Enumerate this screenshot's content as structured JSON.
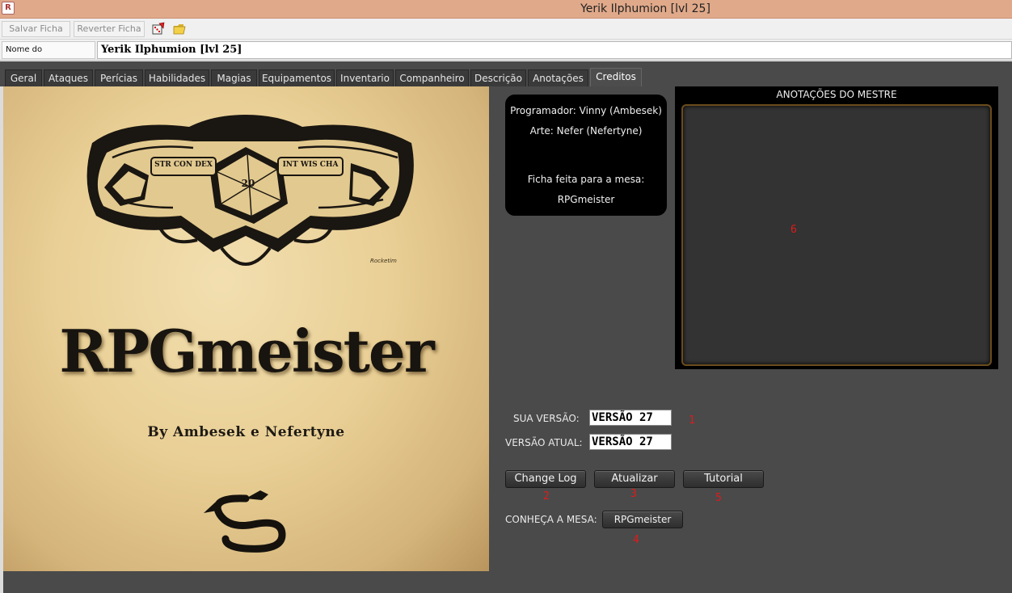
{
  "window": {
    "title": "Yerik Ilphumion [lvl 25]",
    "app_icon_letter": "R"
  },
  "toolbar": {
    "save_label": "Salvar Ficha",
    "revert_label": "Reverter Ficha",
    "icons": [
      "dice-icon",
      "folder-open-icon"
    ]
  },
  "character": {
    "name_label": "Nome do Personagem:",
    "name_value": "Yerik Ilphumion [lvl 25]"
  },
  "tabs": [
    {
      "label": "Geral"
    },
    {
      "label": "Ataques"
    },
    {
      "label": "Perícias"
    },
    {
      "label": "Habilidades"
    },
    {
      "label": "Magias"
    },
    {
      "label": "Equipamentos"
    },
    {
      "label": "Inventario"
    },
    {
      "label": "Companheiro"
    },
    {
      "label": "Descrição"
    },
    {
      "label": "Anotações"
    },
    {
      "label": "Creditos"
    }
  ],
  "active_tab": "Creditos",
  "poster": {
    "dice_stats_left": "STR CON DEX",
    "dice_stats_right": "INT WIS CHA",
    "d20_number": "20",
    "logo_text": "RPGmeister",
    "tagline": "By Ambesek e Nefertyne",
    "artist_signature": "Rocketim"
  },
  "credits": {
    "programmer": "Programador: Vinny (Ambesek)",
    "art": "Arte: Nefer (Nefertyne)",
    "made_for": "Ficha feita para a mesa:",
    "table": "RPGmeister"
  },
  "notes": {
    "title": "ANOTAÇÕES DO MESTRE",
    "content": ""
  },
  "version": {
    "your_label": "SUA VERSÃO:",
    "your_value": "VERSÃO 27",
    "current_label": "VERSÃO ATUAL:",
    "current_value": "VERSÃO 27"
  },
  "buttons": {
    "changelog": "Change Log",
    "update": "Atualizar",
    "tutorial": "Tutorial",
    "meet_label": "CONHEÇA A MESA:",
    "rpgmeister": "RPGmeister"
  },
  "markers": {
    "m1": "1",
    "m2": "2",
    "m3": "3",
    "m4": "4",
    "m5": "5",
    "m6": "6"
  },
  "colors": {
    "titlebar": "#e0a98a",
    "panel_bg": "#4a4a4a",
    "marker_red": "#e01b1b",
    "parchment": "#e9cf95"
  }
}
